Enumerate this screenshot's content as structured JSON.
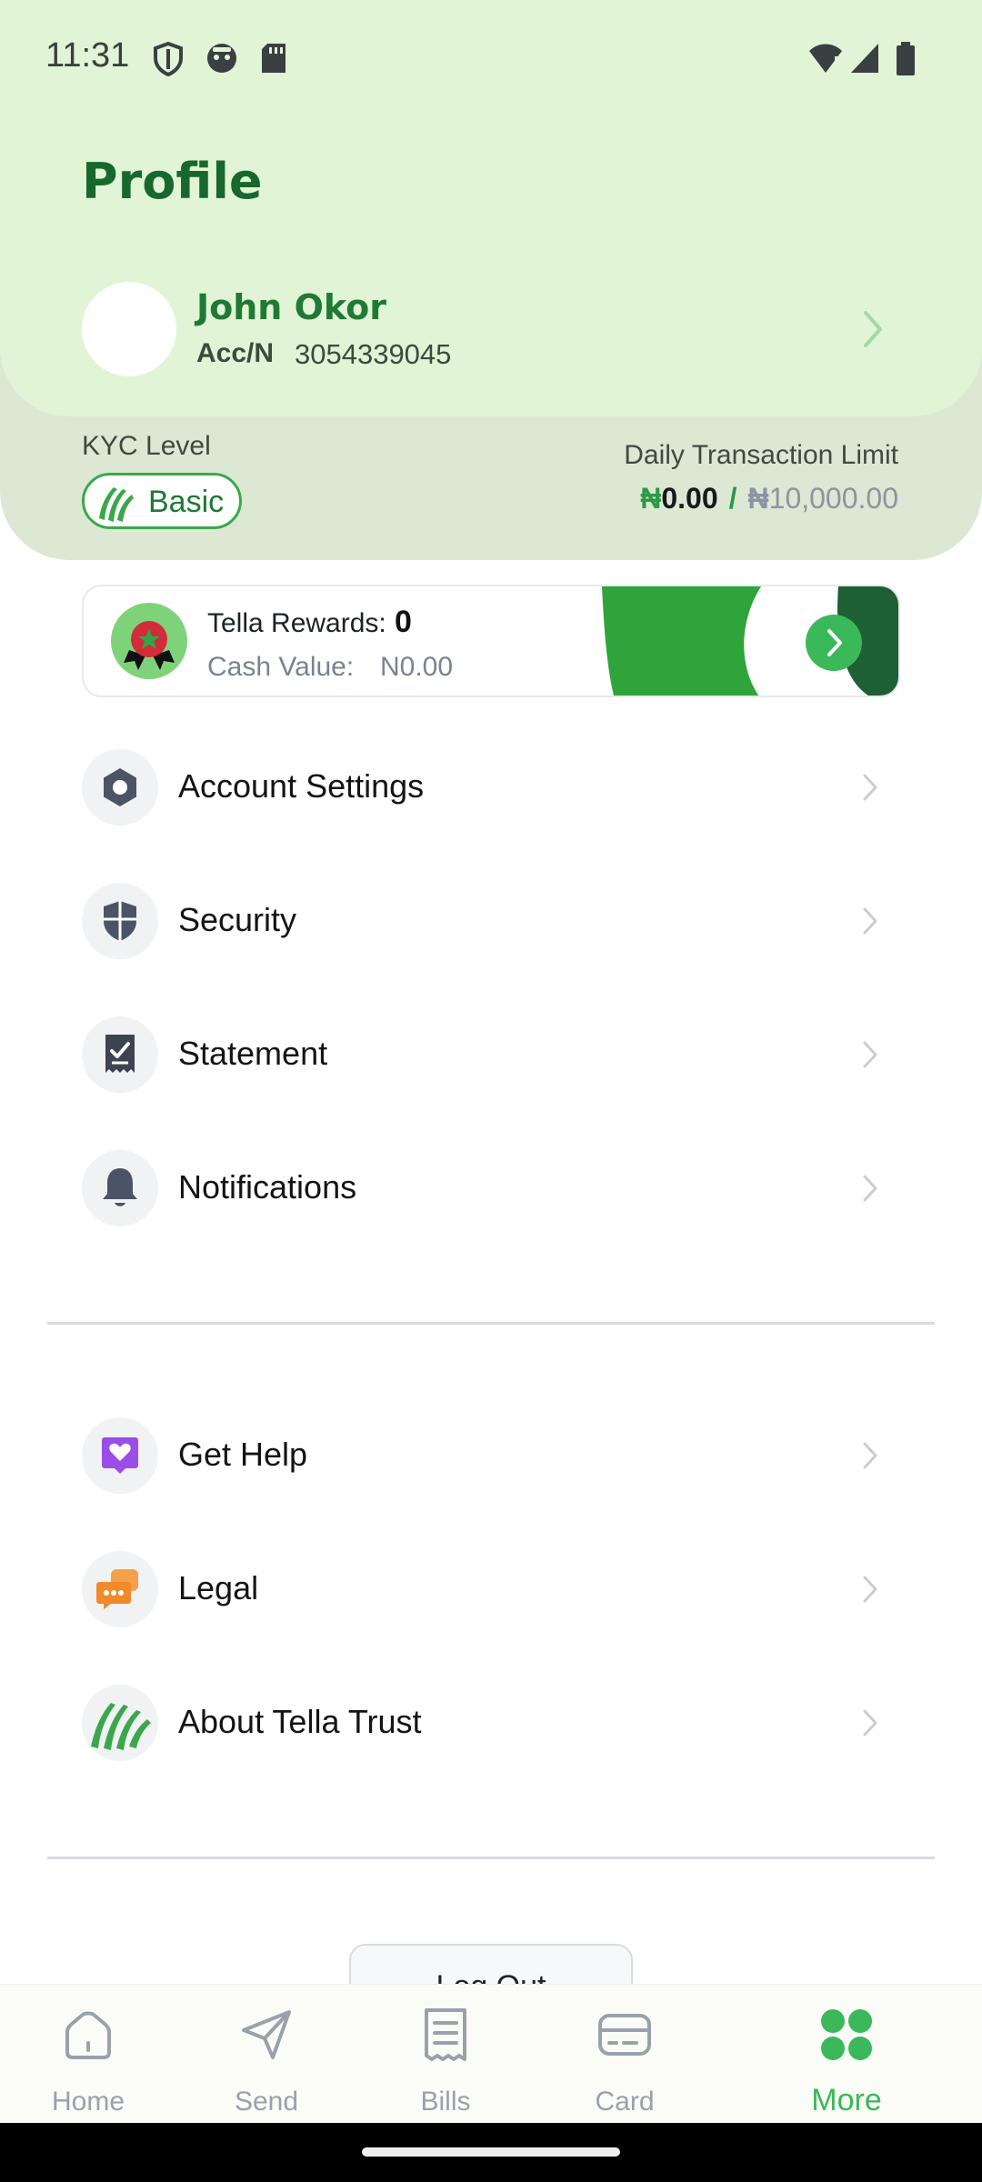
{
  "status_bar": {
    "time": "11:31",
    "left_icons": [
      "shield-icon",
      "face-icon",
      "sd-card-icon"
    ],
    "right_icons": [
      "wifi-alert-icon",
      "signal-icon",
      "battery-icon"
    ]
  },
  "header": {
    "title": "Profile",
    "user_name": "John Okor",
    "acc_label": "Acc/N",
    "acc_number": "3054339045"
  },
  "kyc": {
    "label": "KYC Level",
    "level": "Basic"
  },
  "limit": {
    "label": "Daily Transaction Limit",
    "currency_symbol": "₦",
    "used": "0.00",
    "separator": "/",
    "total": "10,000.00"
  },
  "rewards": {
    "title": "Tella Rewards:",
    "count": "0",
    "cash_label": "Cash Value:",
    "cash_value": "N0.00"
  },
  "menu_primary": [
    {
      "label": "Account Settings",
      "icon": "gear-hex-icon"
    },
    {
      "label": "Security",
      "icon": "shield-icon"
    },
    {
      "label": "Statement",
      "icon": "receipt-check-icon"
    },
    {
      "label": "Notifications",
      "icon": "bell-icon"
    }
  ],
  "menu_secondary": [
    {
      "label": "Get Help",
      "icon": "heart-chat-icon"
    },
    {
      "label": "Legal",
      "icon": "chat-bubbles-icon"
    },
    {
      "label": "About Tella Trust",
      "icon": "tella-logo-icon"
    }
  ],
  "logout": {
    "label": "Log Out"
  },
  "bottom_nav": [
    {
      "label": "Home",
      "icon": "home-icon",
      "active": false
    },
    {
      "label": "Send",
      "icon": "send-icon",
      "active": false
    },
    {
      "label": "Bills",
      "icon": "bills-icon",
      "active": false
    },
    {
      "label": "Card",
      "icon": "card-icon",
      "active": false
    },
    {
      "label": "More",
      "icon": "more-grid-icon",
      "active": true
    }
  ],
  "colors": {
    "brand_green": "#1f7a34",
    "accent_green": "#3bb85a",
    "header_bg": "#e2f4d6",
    "kyc_band_bg": "#dce8d3"
  }
}
